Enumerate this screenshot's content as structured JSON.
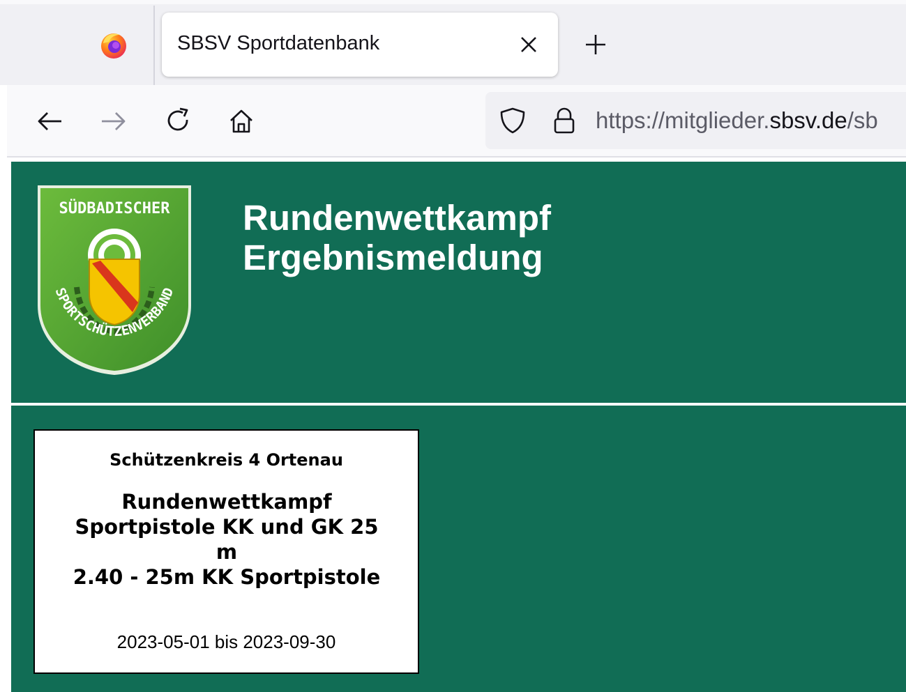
{
  "browser": {
    "tab_title": "SBSV Sportdatenbank",
    "url_scheme": "https://mitglieder.",
    "url_domain": "sbsv.de",
    "url_path": "/sb"
  },
  "header": {
    "title_line1": "Rundenwettkampf",
    "title_line2": "Ergebnismeldung",
    "logo_text_top": "SÜDBADISCHER",
    "logo_text_arc": "SPORTSCHÜTZENVERBAND"
  },
  "competition": {
    "organization": "Schützenkreis 4 Ortenau",
    "name_line1": "Rundenwettkampf",
    "name_line2": "Sportpistole KK und GK 25",
    "name_line3": "m",
    "discipline": "2.40 - 25m KK Sportpistole",
    "date_range": "2023-05-01 bis 2023-09-30"
  },
  "colors": {
    "page_green": "#116d55",
    "logo_green": "#5aa83a",
    "shield_yellow": "#f5c400",
    "shield_red": "#d9361c"
  }
}
